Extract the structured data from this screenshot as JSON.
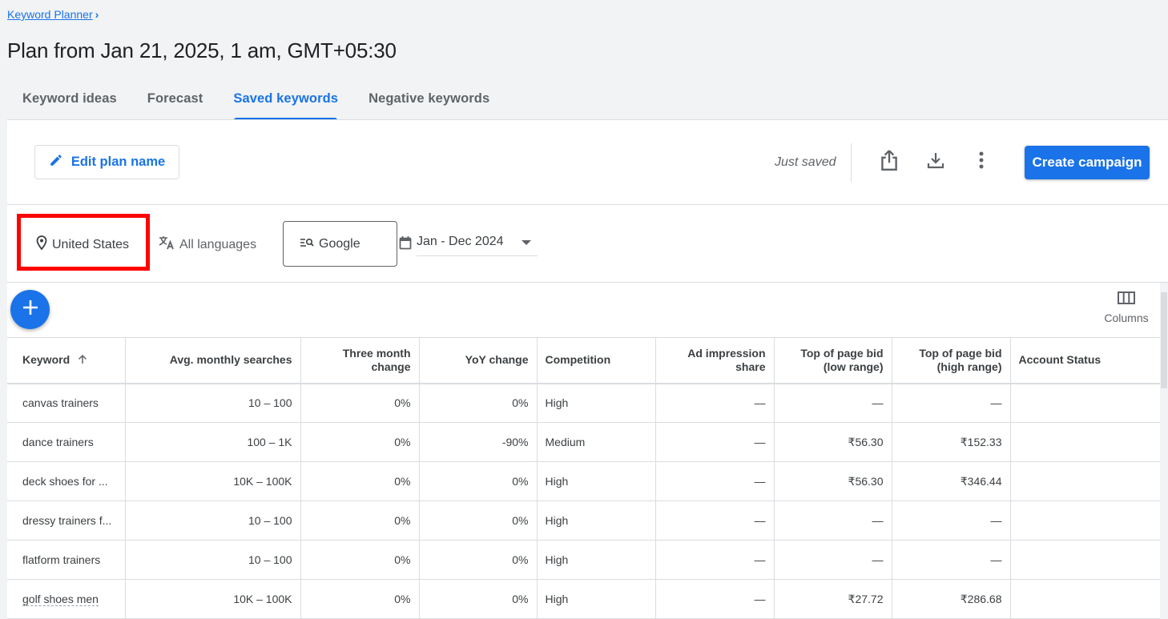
{
  "breadcrumb": {
    "label": "Keyword Planner",
    "chevron": "chevron-right-icon"
  },
  "page_title": "Plan from Jan 21, 2025, 1 am, GMT+05:30",
  "tabs": [
    {
      "label": "Keyword ideas",
      "active": false
    },
    {
      "label": "Forecast",
      "active": false
    },
    {
      "label": "Saved keywords",
      "active": true
    },
    {
      "label": "Negative keywords",
      "active": false
    }
  ],
  "toolbar": {
    "edit_plan_label": "Edit plan name",
    "save_status": "Just saved",
    "share_icon": "share-icon",
    "download_icon": "download-icon",
    "more_icon": "more-vert-icon",
    "create_campaign_label": "Create campaign"
  },
  "filters": {
    "location": "United States",
    "language": "All languages",
    "network": "Google",
    "date_range": "Jan - Dec 2024"
  },
  "columns_label": "Columns",
  "table": {
    "headers": [
      {
        "label": "Keyword",
        "sorted": "ascending"
      },
      {
        "label": "Avg. monthly searches"
      },
      {
        "label": "Three month change"
      },
      {
        "label": "YoY change"
      },
      {
        "label": "Competition"
      },
      {
        "label": "Ad impression share"
      },
      {
        "label": "Top of page bid (low range)"
      },
      {
        "label": "Top of page bid (high range)"
      },
      {
        "label": "Account Status"
      }
    ],
    "header_lines": [
      [
        "Keyword"
      ],
      [
        "Avg. monthly searches"
      ],
      [
        "Three month",
        "change"
      ],
      [
        "YoY change"
      ],
      [
        "Competition"
      ],
      [
        "Ad impression",
        "share"
      ],
      [
        "Top of page bid",
        "(low range)"
      ],
      [
        "Top of page bid",
        "(high range)"
      ],
      [
        "Account Status"
      ]
    ],
    "rows": [
      {
        "keyword": "canvas trainers",
        "avg_searches": "10 – 100",
        "three_month": "0%",
        "yoy": "0%",
        "competition": "High",
        "ad_impression": "—",
        "bid_low": "—",
        "bid_high": "—",
        "status": ""
      },
      {
        "keyword": "dance trainers",
        "avg_searches": "100 – 1K",
        "three_month": "0%",
        "yoy": "-90%",
        "competition": "Medium",
        "ad_impression": "—",
        "bid_low": "₹56.30",
        "bid_high": "₹152.33",
        "status": ""
      },
      {
        "keyword": "deck shoes for ...",
        "avg_searches": "10K – 100K",
        "three_month": "0%",
        "yoy": "0%",
        "competition": "High",
        "ad_impression": "—",
        "bid_low": "₹56.30",
        "bid_high": "₹346.44",
        "status": ""
      },
      {
        "keyword": "dressy trainers f...",
        "avg_searches": "10 – 100",
        "three_month": "0%",
        "yoy": "0%",
        "competition": "High",
        "ad_impression": "—",
        "bid_low": "—",
        "bid_high": "—",
        "status": ""
      },
      {
        "keyword": "flatform trainers",
        "avg_searches": "10 – 100",
        "three_month": "0%",
        "yoy": "0%",
        "competition": "High",
        "ad_impression": "—",
        "bid_low": "—",
        "bid_high": "—",
        "status": ""
      },
      {
        "keyword": "golf shoes men",
        "avg_searches": "10K – 100K",
        "three_month": "0%",
        "yoy": "0%",
        "competition": "High",
        "ad_impression": "—",
        "bid_low": "₹27.72",
        "bid_high": "₹286.68",
        "status": ""
      }
    ]
  },
  "colors": {
    "accent": "#1a73e8",
    "highlight_box": "#ff0000",
    "text": "#3c4043",
    "muted": "#5f6368"
  }
}
